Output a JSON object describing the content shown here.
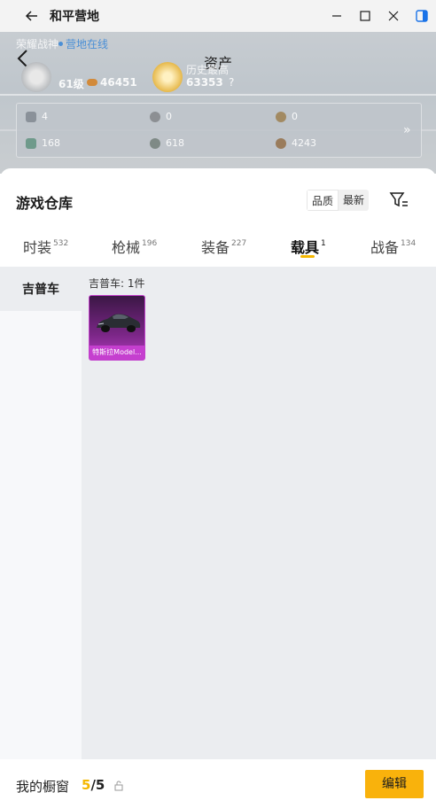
{
  "window": {
    "title": "和平营地",
    "accent": "#1a73e8"
  },
  "header": {
    "title": "资产",
    "online_status": "营地在线",
    "faded_left_label": "荣耀战神",
    "faded_right_label": "历史最高",
    "level": "61级",
    "points": "46451",
    "score": "63353",
    "stats": [
      {
        "value": "4",
        "icon": "card-icon"
      },
      {
        "value": "0",
        "icon": "coin-icon"
      },
      {
        "value": "0",
        "icon": "medal-icon"
      },
      {
        "value": "168",
        "icon": "gem-icon"
      },
      {
        "value": "618",
        "icon": "ball-icon"
      },
      {
        "value": "4243",
        "icon": "bronze-coin-icon"
      }
    ]
  },
  "warehouse": {
    "title": "游戏仓库",
    "sort_options": [
      "品质",
      "最新"
    ],
    "active_sort": "最新"
  },
  "tabs": [
    {
      "label": "时装",
      "count": "532"
    },
    {
      "label": "枪械",
      "count": "196"
    },
    {
      "label": "装备",
      "count": "227"
    },
    {
      "label": "载具",
      "count": "1",
      "active": true
    },
    {
      "label": "战备",
      "count": "134"
    }
  ],
  "categories": [
    {
      "label": "吉普车",
      "active": true
    }
  ],
  "group": {
    "label": "吉普车: 1件"
  },
  "items": [
    {
      "name": "特斯拉Model...",
      "rarity_color": "#c53fcf"
    }
  ],
  "bottom": {
    "label": "我的橱窗",
    "count_current": "5",
    "count_total": "/5",
    "edit_label": "编辑"
  },
  "colors": {
    "highlight": "#f9b20c",
    "online": "#4a8fd6"
  }
}
